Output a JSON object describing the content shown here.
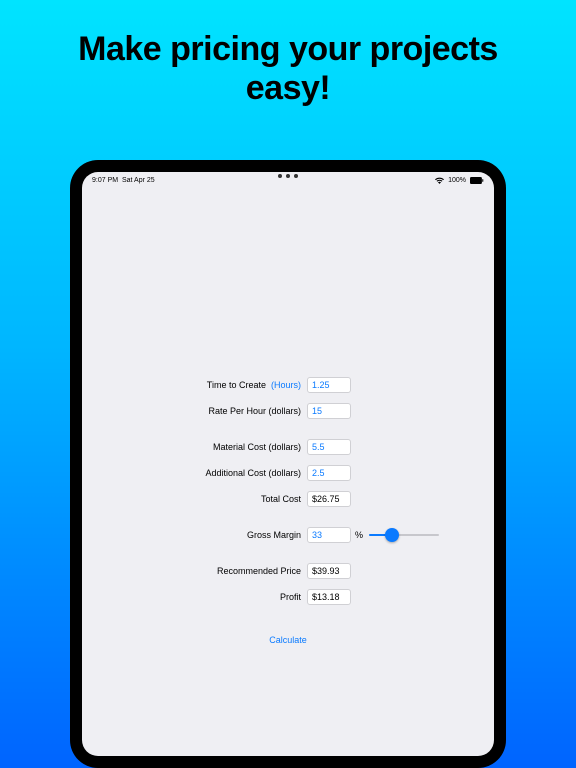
{
  "headline_line1": "Make pricing your projects",
  "headline_line2": "easy!",
  "status": {
    "time": "9:07 PM",
    "date": "Sat Apr 25",
    "battery": "100%"
  },
  "form": {
    "time_to_create": {
      "label": "Time to Create",
      "unit": "(Hours)",
      "value": "1.25"
    },
    "rate_per_hour": {
      "label": "Rate Per Hour (dollars)",
      "value": "15"
    },
    "material_cost": {
      "label": "Material Cost (dollars)",
      "value": "5.5"
    },
    "additional_cost": {
      "label": "Additional Cost (dollars)",
      "value": "2.5"
    },
    "total_cost": {
      "label": "Total Cost",
      "value": "$26.75"
    },
    "gross_margin": {
      "label": "Gross Margin",
      "value": "33",
      "pct": "%"
    },
    "recommended": {
      "label": "Recommended Price",
      "value": "$39.93"
    },
    "profit": {
      "label": "Profit",
      "value": "$13.18"
    },
    "calculate_label": "Calculate",
    "slider_percent": 33
  }
}
